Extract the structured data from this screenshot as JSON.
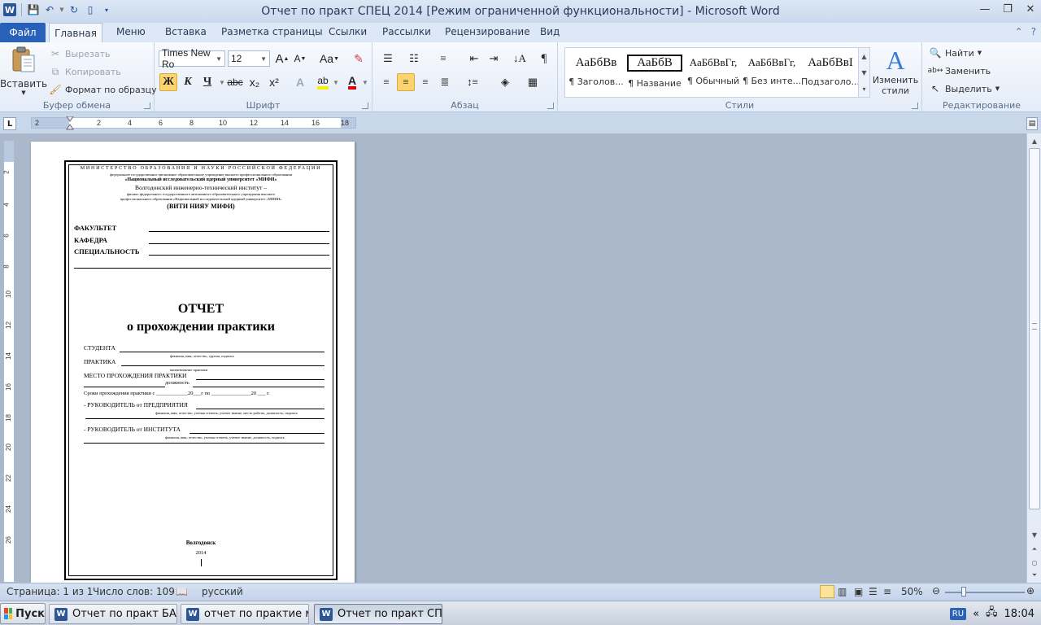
{
  "window": {
    "title": "Отчет по практ СПЕЦ 2014 [Режим ограниченной функциональности]  -  Microsoft Word"
  },
  "tabs": {
    "file": "Файл",
    "items": [
      "Главная",
      "Меню",
      "Вставка",
      "Разметка страницы",
      "Ссылки",
      "Рассылки",
      "Рецензирование",
      "Вид"
    ]
  },
  "clipboard": {
    "paste": "Вставить",
    "cut": "Вырезать",
    "copy": "Копировать",
    "format_painter": "Формат по образцу",
    "label": "Буфер обмена"
  },
  "font": {
    "name": "Times New Ro",
    "size": "12",
    "bold": "Ж",
    "italic": "К",
    "underline": "Ч",
    "strike": "abc",
    "subscript": "x₂",
    "superscript": "x²",
    "grow": "A",
    "shrink": "A",
    "case": "Aa",
    "label": "Шрифт"
  },
  "paragraph": {
    "label": "Абзац",
    "pilcrow": "¶"
  },
  "styles": {
    "label": "Стили",
    "items": [
      {
        "sample": "АаБбВв",
        "name": "¶ Заголов..."
      },
      {
        "sample": "АаБбВ",
        "name": "¶ Название"
      },
      {
        "sample": "АаБбВвГг,",
        "name": "¶ Обычный"
      },
      {
        "sample": "АаБбВвГг,",
        "name": "¶ Без инте..."
      },
      {
        "sample": "АаБбВвI",
        "name": "Подзаголо..."
      }
    ],
    "change_styles_1": "Изменить",
    "change_styles_2": "стили"
  },
  "editing": {
    "label": "Редактирование",
    "find": "Найти",
    "replace": "Заменить",
    "select": "Выделить"
  },
  "ruler": {
    "h_ticks": [
      "2",
      "2",
      "4",
      "6",
      "8",
      "10",
      "12",
      "14",
      "16",
      "18"
    ],
    "v_ticks": [
      "2",
      "4",
      "6",
      "8",
      "10",
      "12",
      "14",
      "16",
      "18",
      "20",
      "22",
      "24",
      "26"
    ]
  },
  "document": {
    "ministry": "МИНИСТЕРСТВО ОБРАЗОВАНИЯ И НАУКИ РОССИЙСКОЙ ФЕДЕРАЦИИ",
    "fed_line": "федеральное государственное автономное образовательное учреждение высшего профессионального образования",
    "univ": "«Национальный исследовательский ядерный университет «МИФИ»",
    "institute": "Волгодонский инженерно-технический институт –",
    "branch_1": "филиал федерального государственного автономного образовательного учреждения высшего",
    "branch_2": "профессионального образования «Национальный исследовательский ядерный университет «МИФИ»",
    "abbr": "(ВИТИ НИЯУ МИФИ)",
    "faculty": "ФАКУЛЬТЕТ",
    "department": "КАФЕДРА",
    "specialty": "СПЕЦИАЛЬНОСТЬ",
    "report_title": "ОТЧЕТ",
    "report_subtitle": "о прохождении практики",
    "student": "СТУДЕНТА",
    "student_hint": "фамилия, имя, отчество, группа, подпись",
    "practice": "ПРАКТИКА",
    "practice_hint": "наименование практики",
    "place": "МЕСТО ПРОХОЖДЕНИЯ ПРАКТИКИ",
    "position": "должность",
    "dates": "Сроки прохождения практики с ____________20___г по _______________20 ___ г.",
    "head_company": "- РУКОВОДИТЕЛЬ от ПРЕДПРИЯТИЯ",
    "head_company_hint": "фамилия, имя, отчество, ученая степень, ученое звание, место работы, должность, подпись",
    "head_institute": "- РУКОВОДИТЕЛЬ от ИНСТИТУТА",
    "head_institute_hint": "фамилия, имя, отчество, ученая степень, ученое звание, должность, подпись",
    "city": "Волгодонск",
    "year": "2014"
  },
  "status": {
    "page": "Страница: 1 из 1",
    "words": "Число слов: 109",
    "language": "русский",
    "zoom": "50%"
  },
  "taskbar": {
    "start": "Пуск",
    "tasks": [
      "Отчет по практ БА...",
      "отчет по практие м...",
      "Отчет по практ СП..."
    ],
    "lang": "RU",
    "time": "18:04"
  }
}
